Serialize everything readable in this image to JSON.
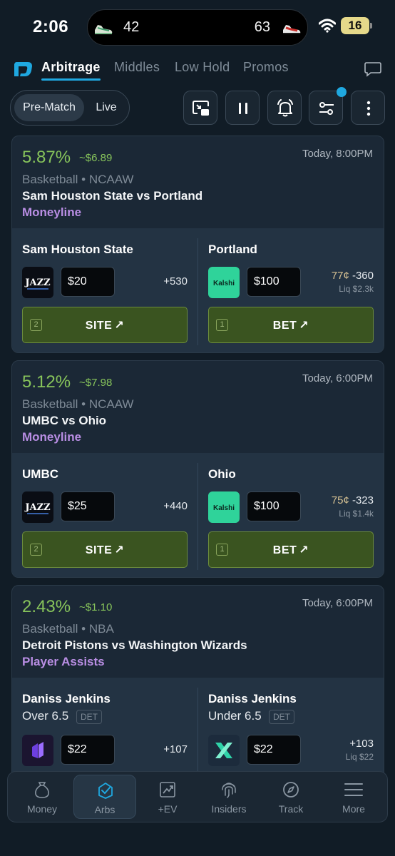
{
  "status_bar": {
    "time": "2:06",
    "score_left": "42",
    "score_right": "63",
    "battery": "16"
  },
  "nav": {
    "tabs": [
      {
        "label": "Arbitrage"
      },
      {
        "label": "Middles"
      },
      {
        "label": "Low Hold"
      },
      {
        "label": "Promos"
      }
    ]
  },
  "toolbar": {
    "pre_match_label": "Pre-Match",
    "live_label": "Live"
  },
  "cards": [
    {
      "percent": "5.87%",
      "profit": "~$6.89",
      "time": "Today, 8:00PM",
      "league": "Basketball • NCAAW",
      "matchup": "Sam Houston State vs Portland",
      "market": "Moneyline",
      "left": {
        "name": "Sam Houston State",
        "book": "JAZZ",
        "stake": "$20",
        "odds": "+530",
        "button_num": "2",
        "button_label": "SITE"
      },
      "right": {
        "name": "Portland",
        "book": "Kalshi",
        "stake": "$100",
        "cents": "77¢",
        "odds": "-360",
        "liq": "Liq $2.3k",
        "button_num": "1",
        "button_label": "BET"
      }
    },
    {
      "percent": "5.12%",
      "profit": "~$7.98",
      "time": "Today, 6:00PM",
      "league": "Basketball • NCAAW",
      "matchup": "UMBC vs Ohio",
      "market": "Moneyline",
      "left": {
        "name": "UMBC",
        "book": "JAZZ",
        "stake": "$25",
        "odds": "+440",
        "button_num": "2",
        "button_label": "SITE"
      },
      "right": {
        "name": "Ohio",
        "book": "Kalshi",
        "stake": "$100",
        "cents": "75¢",
        "odds": "-323",
        "liq": "Liq $1.4k",
        "button_num": "1",
        "button_label": "BET"
      }
    },
    {
      "percent": "2.43%",
      "profit": "~$1.10",
      "time": "Today, 6:00PM",
      "league": "Basketball • NBA",
      "matchup": "Detroit Pistons vs Washington Wizards",
      "market": "Player Assists",
      "left": {
        "name": "Daniss Jenkins",
        "sub": "Over 6.5",
        "badge": "DET",
        "stake": "$22",
        "odds": "+107"
      },
      "right": {
        "name": "Daniss Jenkins",
        "sub": "Under 6.5",
        "badge": "DET",
        "stake": "$22",
        "odds": "+103",
        "liq": "Liq $22"
      }
    }
  ],
  "bottom_nav": [
    {
      "label": "Money",
      "icon": "money-bag-icon"
    },
    {
      "label": "Arbs",
      "icon": "arbs-icon"
    },
    {
      "label": "+EV",
      "icon": "chart-up-icon"
    },
    {
      "label": "Insiders",
      "icon": "fingerprint-icon"
    },
    {
      "label": "Track",
      "icon": "compass-icon"
    },
    {
      "label": "More",
      "icon": "menu-icon"
    }
  ],
  "colors": {
    "accent": "#1fa8e0",
    "profit_green": "#87c45b",
    "market_purple": "#b98ee4",
    "button_green": "#3a5420",
    "kalshi": "#2fd39a"
  }
}
